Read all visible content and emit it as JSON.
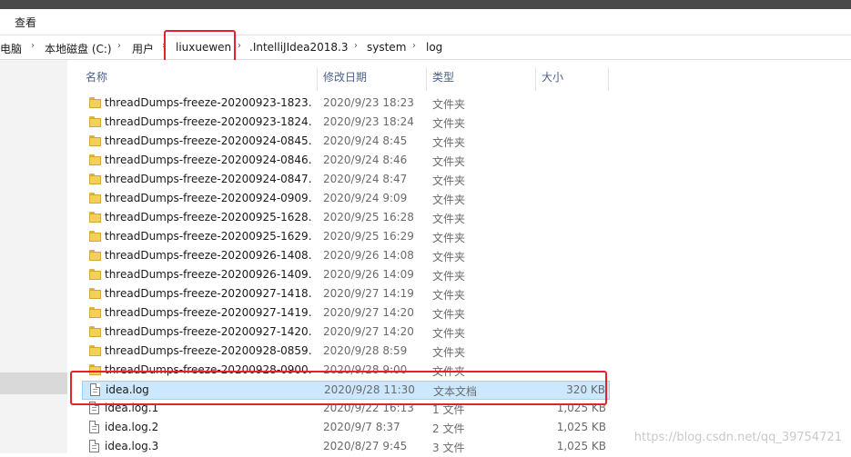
{
  "menu": {
    "view_label": "查看"
  },
  "breadcrumb": [
    "电脑",
    "本地磁盘 (C:)",
    "用户",
    "liuxuewen",
    ".IntelliJIdea2018.3",
    "system",
    "log"
  ],
  "columns": {
    "name": "名称",
    "date": "修改日期",
    "type": "类型",
    "size": "大小"
  },
  "rows": [
    {
      "name": "threadDumps-freeze-20200923-1823...",
      "date": "2020/9/23 18:23",
      "type": "文件夹",
      "size": "",
      "kind": "folder"
    },
    {
      "name": "threadDumps-freeze-20200923-1824...",
      "date": "2020/9/23 18:24",
      "type": "文件夹",
      "size": "",
      "kind": "folder"
    },
    {
      "name": "threadDumps-freeze-20200924-0845...",
      "date": "2020/9/24 8:45",
      "type": "文件夹",
      "size": "",
      "kind": "folder"
    },
    {
      "name": "threadDumps-freeze-20200924-0846...",
      "date": "2020/9/24 8:46",
      "type": "文件夹",
      "size": "",
      "kind": "folder"
    },
    {
      "name": "threadDumps-freeze-20200924-0847...",
      "date": "2020/9/24 8:47",
      "type": "文件夹",
      "size": "",
      "kind": "folder"
    },
    {
      "name": "threadDumps-freeze-20200924-0909...",
      "date": "2020/9/24 9:09",
      "type": "文件夹",
      "size": "",
      "kind": "folder"
    },
    {
      "name": "threadDumps-freeze-20200925-1628...",
      "date": "2020/9/25 16:28",
      "type": "文件夹",
      "size": "",
      "kind": "folder"
    },
    {
      "name": "threadDumps-freeze-20200925-1629...",
      "date": "2020/9/25 16:29",
      "type": "文件夹",
      "size": "",
      "kind": "folder"
    },
    {
      "name": "threadDumps-freeze-20200926-1408...",
      "date": "2020/9/26 14:08",
      "type": "文件夹",
      "size": "",
      "kind": "folder"
    },
    {
      "name": "threadDumps-freeze-20200926-1409...",
      "date": "2020/9/26 14:09",
      "type": "文件夹",
      "size": "",
      "kind": "folder"
    },
    {
      "name": "threadDumps-freeze-20200927-1418...",
      "date": "2020/9/27 14:19",
      "type": "文件夹",
      "size": "",
      "kind": "folder"
    },
    {
      "name": "threadDumps-freeze-20200927-1419...",
      "date": "2020/9/27 14:20",
      "type": "文件夹",
      "size": "",
      "kind": "folder"
    },
    {
      "name": "threadDumps-freeze-20200927-1420...",
      "date": "2020/9/27 14:20",
      "type": "文件夹",
      "size": "",
      "kind": "folder"
    },
    {
      "name": "threadDumps-freeze-20200928-0859...",
      "date": "2020/9/28 8:59",
      "type": "文件夹",
      "size": "",
      "kind": "folder"
    },
    {
      "name": "threadDumps-freeze-20200928-0900...",
      "date": "2020/9/28 9:00",
      "type": "文件夹",
      "size": "",
      "kind": "folder"
    },
    {
      "name": "idea.log",
      "date": "2020/9/28 11:30",
      "type": "文本文档",
      "size": "320 KB",
      "kind": "file",
      "selected": true
    },
    {
      "name": "idea.log.1",
      "date": "2020/9/22 16:13",
      "type": "1 文件",
      "size": "1,025 KB",
      "kind": "file"
    },
    {
      "name": "idea.log.2",
      "date": "2020/9/7 8:37",
      "type": "2 文件",
      "size": "1,025 KB",
      "kind": "file"
    },
    {
      "name": "idea.log.3",
      "date": "2020/8/27 9:45",
      "type": "3 文件",
      "size": "1,025 KB",
      "kind": "file"
    }
  ],
  "watermark": "https://blog.csdn.net/qq_39754721",
  "colors": {
    "selection": "#cce8ff",
    "highlight": "#e8202a",
    "folder": "#f6cf57"
  }
}
